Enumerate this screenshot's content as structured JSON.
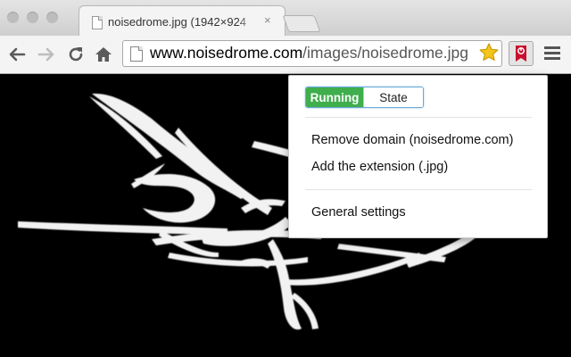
{
  "window": {
    "tab_title": "noisedrome.jpg (1942×924",
    "tab_close": "×"
  },
  "toolbar": {
    "url_host": "www.noisedrome.com",
    "url_path": "/images/noisedrome.jpg",
    "bookmark_star_color": "#f5c518",
    "extension_icon_color": "#c8102e"
  },
  "popup": {
    "toggle_on_label": "Running",
    "toggle_off_label": "State",
    "items": [
      {
        "label": "Remove domain (noisedrome.com)"
      },
      {
        "label": "Add the extension (.jpg)"
      },
      {
        "label": "General settings"
      }
    ],
    "accent_color": "#3fae4c"
  }
}
